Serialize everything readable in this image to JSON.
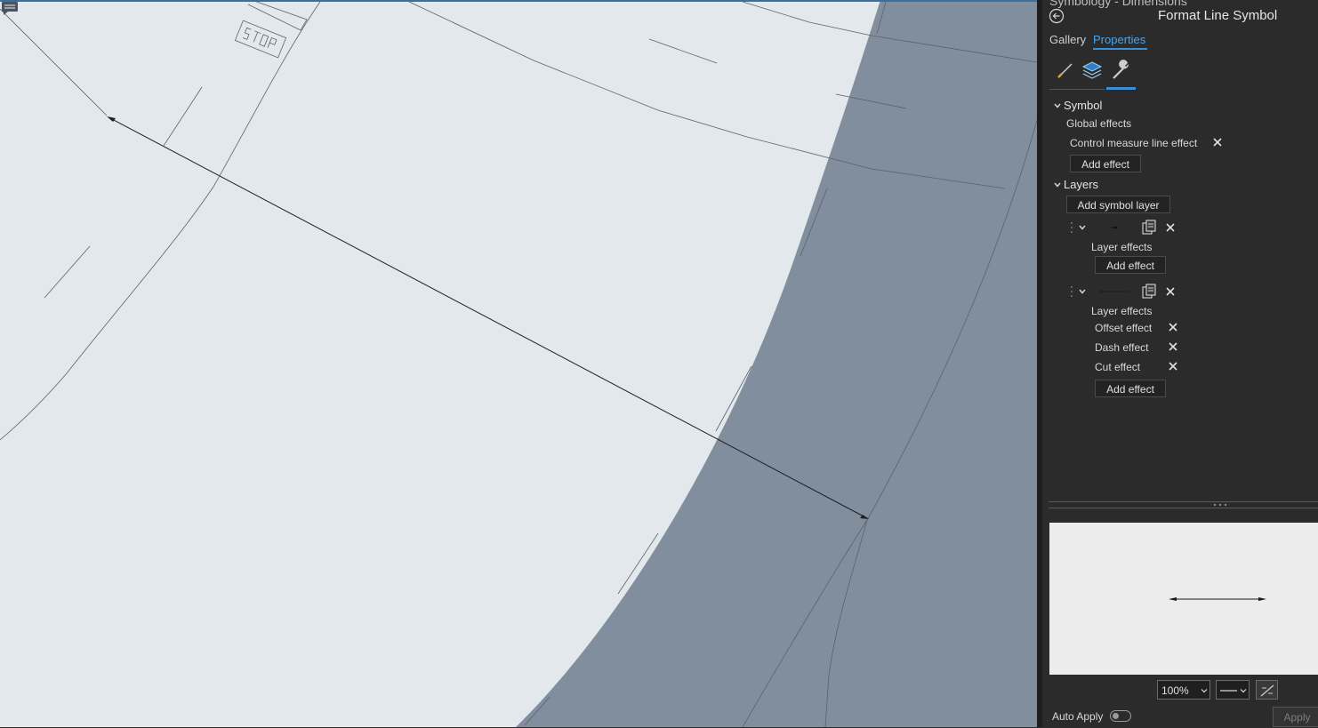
{
  "pane": {
    "header_partial": "Symbology - Dimensions",
    "title": "Format Line Symbol",
    "tabs": [
      {
        "label": "Gallery",
        "active": false
      },
      {
        "label": "Properties",
        "active": true
      }
    ],
    "tool_icons": [
      "brush-icon",
      "layers-icon",
      "wrench-icon"
    ],
    "symbol_section": {
      "label": "Symbol",
      "global_effects_label": "Global effects",
      "effects": [
        "Control measure line effect"
      ],
      "add_effect_label": "Add effect"
    },
    "layers_section": {
      "label": "Layers",
      "add_layer_label": "Add symbol layer",
      "layers": [
        {
          "effects_label": "Layer effects",
          "effects": [],
          "add_effect_label": "Add effect"
        },
        {
          "effects_label": "Layer effects",
          "effects": [
            "Offset effect",
            "Dash effect",
            "Cut effect"
          ],
          "add_effect_label": "Add effect"
        }
      ]
    },
    "footer": {
      "zoom": "100%",
      "auto_apply_label": "Auto Apply",
      "auto_apply_on": false,
      "apply_label": "Apply"
    }
  },
  "colors": {
    "accent": "#3b8fd6",
    "map_background": "#e2e8ec",
    "map_band": "#808e9e",
    "pane_background": "#2b2b2b"
  }
}
